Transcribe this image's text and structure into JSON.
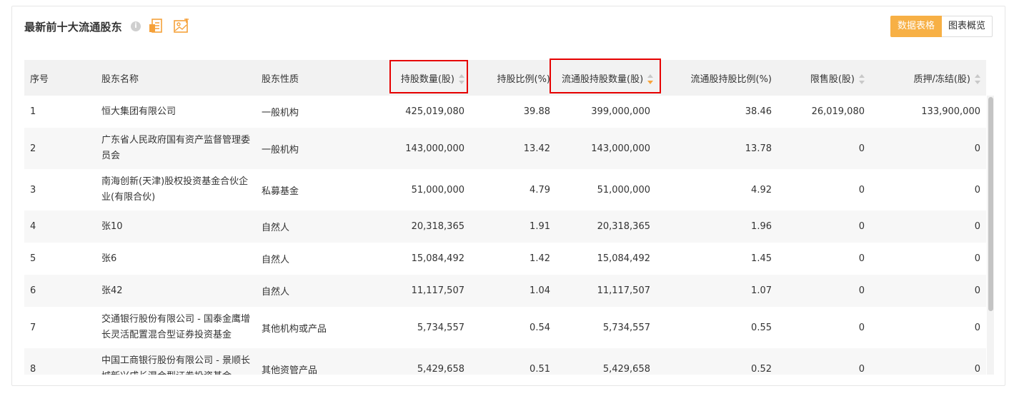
{
  "header": {
    "title": "最新前十大流通股东",
    "info_icon": "i",
    "toggle": {
      "table_label": "数据表格",
      "chart_label": "图表概览"
    }
  },
  "table": {
    "columns": {
      "rank": "序号",
      "name": "股东名称",
      "type": "股东性质",
      "shares": "持股数量(股)",
      "ratio": "持股比例(%)",
      "float_shares": "流通股持股数量(股)",
      "float_ratio": "流通股持股比例(%)",
      "restricted": "限售股(股)",
      "pledged": "质押/冻结(股)"
    },
    "rows": [
      {
        "rank": "1",
        "name": "恒大集团有限公司",
        "type": "一般机构",
        "shares": "425,019,080",
        "ratio": "39.88",
        "float_shares": "399,000,000",
        "float_ratio": "38.46",
        "restricted": "26,019,080",
        "pledged": "133,900,000"
      },
      {
        "rank": "2",
        "name": "广东省人民政府国有资产监督管理委员会",
        "type": "一般机构",
        "shares": "143,000,000",
        "ratio": "13.42",
        "float_shares": "143,000,000",
        "float_ratio": "13.78",
        "restricted": "0",
        "pledged": "0"
      },
      {
        "rank": "3",
        "name": "南海创新(天津)股权投资基金合伙企业(有限合伙)",
        "type": "私募基金",
        "shares": "51,000,000",
        "ratio": "4.79",
        "float_shares": "51,000,000",
        "float_ratio": "4.92",
        "restricted": "0",
        "pledged": "0"
      },
      {
        "rank": "4",
        "name": "张10",
        "type": "自然人",
        "shares": "20,318,365",
        "ratio": "1.91",
        "float_shares": "20,318,365",
        "float_ratio": "1.96",
        "restricted": "0",
        "pledged": "0"
      },
      {
        "rank": "5",
        "name": "张6",
        "type": "自然人",
        "shares": "15,084,492",
        "ratio": "1.42",
        "float_shares": "15,084,492",
        "float_ratio": "1.45",
        "restricted": "0",
        "pledged": "0"
      },
      {
        "rank": "6",
        "name": "张42",
        "type": "自然人",
        "shares": "11,117,507",
        "ratio": "1.04",
        "float_shares": "11,117,507",
        "float_ratio": "1.07",
        "restricted": "0",
        "pledged": "0"
      },
      {
        "rank": "7",
        "name": "交通银行股份有限公司 - 国泰金鹰增长灵活配置混合型证券投资基金",
        "type": "其他机构或产品",
        "shares": "5,734,557",
        "ratio": "0.54",
        "float_shares": "5,734,557",
        "float_ratio": "0.55",
        "restricted": "0",
        "pledged": "0"
      },
      {
        "rank": "8",
        "name": "中国工商银行股份有限公司 - 景顺长城新兴成长混合型证券投资基金",
        "type": "其他资管产品",
        "shares": "5,429,658",
        "ratio": "0.51",
        "float_shares": "5,429,658",
        "float_ratio": "0.52",
        "restricted": "0",
        "pledged": "0"
      }
    ]
  },
  "colors": {
    "accent": "#f7b045",
    "highlight_box": "#e60000",
    "sort_active": "#f7a33a"
  }
}
